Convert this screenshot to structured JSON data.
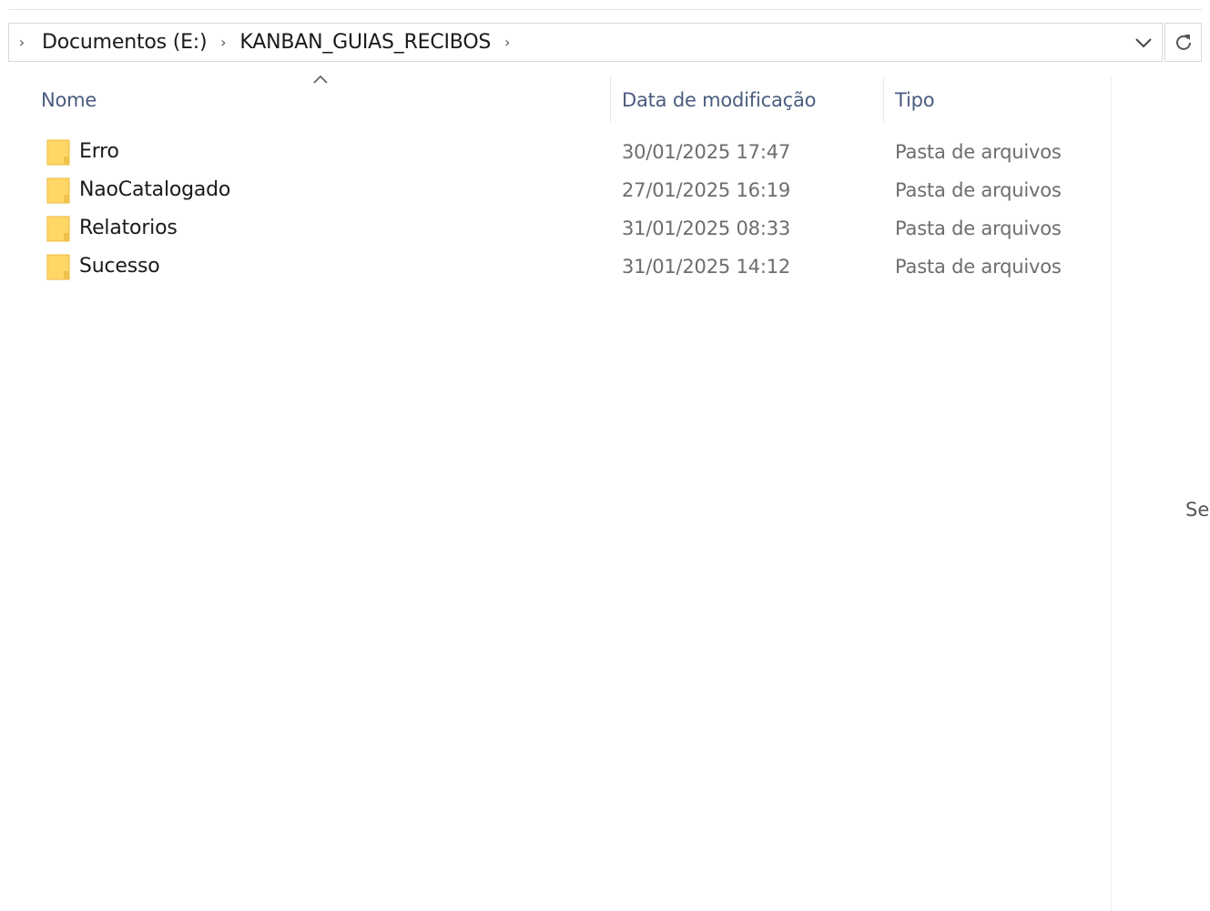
{
  "breadcrumb": {
    "items": [
      {
        "label": "Documentos (E:)"
      },
      {
        "label": "KANBAN_GUIAS_RECIBOS"
      }
    ]
  },
  "columns": {
    "name": "Nome",
    "modified": "Data de modificação",
    "type": "Tipo"
  },
  "files": [
    {
      "name": "Erro",
      "modified": "30/01/2025 17:47",
      "type": "Pasta de arquivos",
      "icon": "folder-icon"
    },
    {
      "name": "NaoCatalogado",
      "modified": "27/01/2025 16:19",
      "type": "Pasta de arquivos",
      "icon": "folder-icon"
    },
    {
      "name": "Relatorios",
      "modified": "31/01/2025 08:33",
      "type": "Pasta de arquivos",
      "icon": "folder-icon"
    },
    {
      "name": "Sucesso",
      "modified": "31/01/2025 14:12",
      "type": "Pasta de arquivos",
      "icon": "folder-icon"
    }
  ],
  "side_panel": {
    "partial_text": "Se"
  },
  "colors": {
    "header_text": "#4a5c7e",
    "folder_fill": "#ffd766",
    "folder_edge": "#e8b93c",
    "secondary_text": "#6d6d6d"
  }
}
